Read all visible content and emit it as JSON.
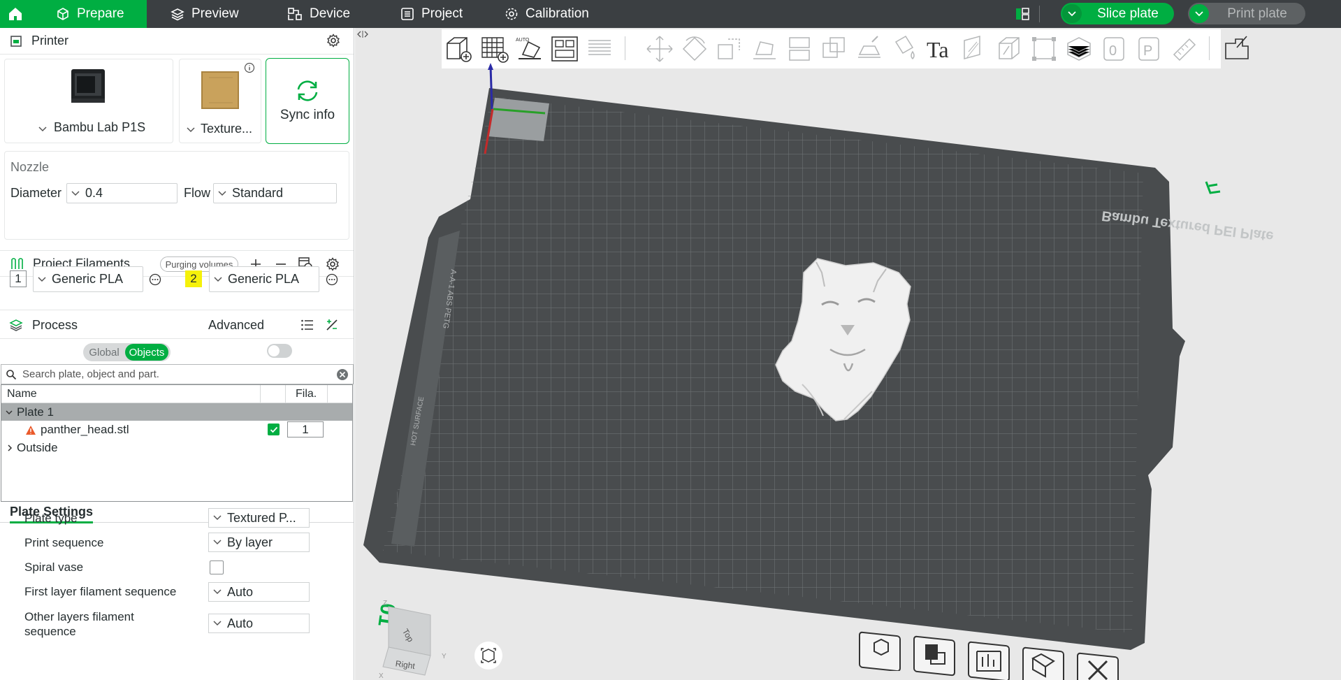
{
  "topbar": {
    "tabs": [
      "Prepare",
      "Preview",
      "Device",
      "Project",
      "Calibration"
    ],
    "slice_label": "Slice plate",
    "print_label": "Print plate"
  },
  "printer": {
    "section_title": "Printer",
    "printer_name": "Bambu Lab P1S",
    "plate_name": "Texture...",
    "sync_label": "Sync info",
    "nozzle_title": "Nozzle",
    "diameter_label": "Diameter",
    "diameter_value": "0.4",
    "flow_label": "Flow",
    "flow_value": "Standard"
  },
  "filaments": {
    "title": "Project Filaments",
    "purging_label": "Purging volumes",
    "items": [
      {
        "index": "1",
        "name": "Generic PLA",
        "color": "#ffffff"
      },
      {
        "index": "2",
        "name": "Generic PLA",
        "color": "#f5f10a"
      }
    ]
  },
  "process": {
    "title": "Process",
    "global_label": "Global",
    "objects_label": "Objects",
    "advanced_label": "Advanced",
    "search_placeholder": "Search plate, object and part."
  },
  "object_list": {
    "col_name": "Name",
    "col_fila": "Fila.",
    "plate_label": "Plate 1",
    "object_name": "panther_head.stl",
    "object_fila": "1",
    "outside_label": "Outside"
  },
  "plate_settings": {
    "tab_label": "Plate Settings",
    "plate_type_label": "Plate type",
    "plate_type_value": "Textured P...",
    "print_sequence_label": "Print sequence",
    "print_sequence_value": "By layer",
    "spiral_vase_label": "Spiral vase",
    "first_layer_label": "First layer filament sequence",
    "first_layer_value": "Auto",
    "other_layers_label": "Other layers filament sequence",
    "other_layers_value": "Auto"
  },
  "viewport": {
    "plate_brand_text": "Bambu Textured PEI Plate",
    "plate_number": "01",
    "side_label": "A-A-1 ABS PETG",
    "hot_surface_label": "HOT SURFACE",
    "view_cube_top": "Top",
    "view_cube_right": "Right",
    "axis_z": "Z",
    "axis_y": "Y",
    "axis_x": "X",
    "text_tool_glyph": "Ta",
    "tool_glyph_0": "0",
    "tool_glyph_p": "P",
    "auto_tag": "AUTO"
  },
  "colors": {
    "accent": "#00ae42",
    "topbar_bg": "#3b3f42",
    "plate_bg": "#494c4e",
    "viewport_bg": "#e8e8e8"
  }
}
